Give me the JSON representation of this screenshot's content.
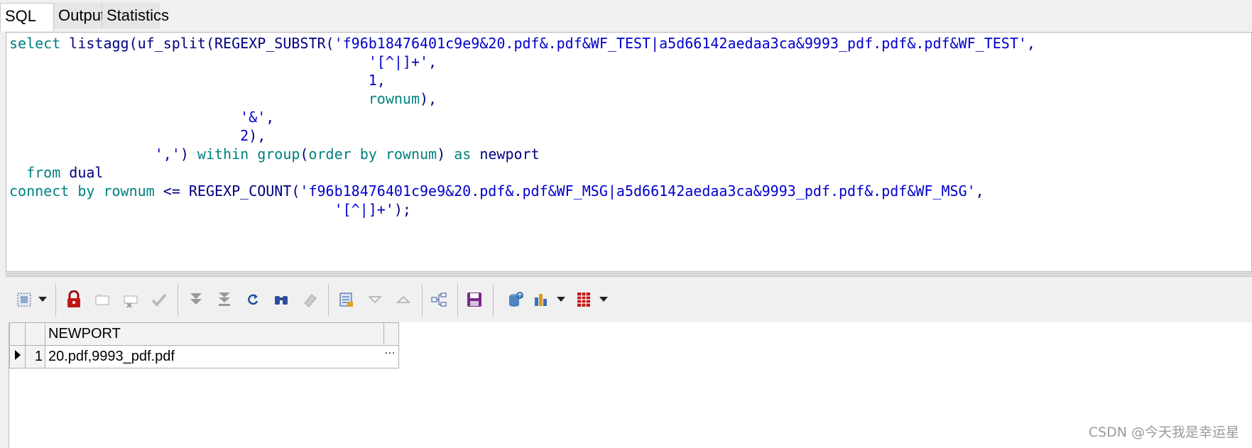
{
  "tabs": [
    {
      "label": "SQL",
      "active": true
    },
    {
      "label": "Output",
      "active": false
    },
    {
      "label": "Statistics",
      "active": false
    }
  ],
  "editor": {
    "lines": [
      [
        {
          "t": "kw",
          "v": "select"
        },
        {
          "t": "",
          "v": " "
        },
        {
          "t": "fn",
          "v": "listagg(uf_split(REGEXP_SUBSTR("
        },
        {
          "t": "str",
          "v": "'f96b18476401c9e9&20.pdf&.pdf&WF_TEST|a5d66142aedaa3ca&9993_pdf.pdf&.pdf&WF_TEST'"
        },
        {
          "t": "fn",
          "v": ","
        }
      ],
      [
        {
          "t": "",
          "v": "                                          "
        },
        {
          "t": "str",
          "v": "'[^|]+'"
        },
        {
          "t": "fn",
          "v": ","
        }
      ],
      [
        {
          "t": "",
          "v": "                                          "
        },
        {
          "t": "num",
          "v": "1"
        },
        {
          "t": "fn",
          "v": ","
        }
      ],
      [
        {
          "t": "",
          "v": "                                          "
        },
        {
          "t": "kw",
          "v": "rownum"
        },
        {
          "t": "fn",
          "v": "),"
        }
      ],
      [
        {
          "t": "",
          "v": "                           "
        },
        {
          "t": "str",
          "v": "'&'"
        },
        {
          "t": "fn",
          "v": ","
        }
      ],
      [
        {
          "t": "",
          "v": "                           "
        },
        {
          "t": "num",
          "v": "2"
        },
        {
          "t": "fn",
          "v": "),"
        }
      ],
      [
        {
          "t": "",
          "v": "                 "
        },
        {
          "t": "str",
          "v": "','"
        },
        {
          "t": "fn",
          "v": ") "
        },
        {
          "t": "kw",
          "v": "within group"
        },
        {
          "t": "fn",
          "v": "("
        },
        {
          "t": "kw",
          "v": "order by rownum"
        },
        {
          "t": "fn",
          "v": ") "
        },
        {
          "t": "kw",
          "v": "as"
        },
        {
          "t": "fn",
          "v": " newport"
        }
      ],
      [
        {
          "t": "",
          "v": "  "
        },
        {
          "t": "kw",
          "v": "from"
        },
        {
          "t": "fn",
          "v": " dual"
        }
      ],
      [
        {
          "t": "kw",
          "v": "connect by rownum"
        },
        {
          "t": "fn",
          "v": " <= REGEXP_COUNT("
        },
        {
          "t": "str",
          "v": "'f96b18476401c9e9&20.pdf&.pdf&WF_MSG|a5d66142aedaa3ca&9993_pdf.pdf&.pdf&WF_MSG'"
        },
        {
          "t": "fn",
          "v": ","
        }
      ],
      [
        {
          "t": "",
          "v": "                                      "
        },
        {
          "t": "str",
          "v": "'[^|]+'"
        },
        {
          "t": "fn",
          "v": ");"
        }
      ]
    ]
  },
  "toolbar": {
    "buttons": [
      "select-mode-icon",
      "lock-icon",
      "insert-record-icon",
      "delete-record-icon",
      "post-record-icon",
      "fetch-next-icon",
      "fetch-last-icon",
      "refresh-icon",
      "find-icon",
      "clear-icon",
      "single-record-view-icon",
      "next-record-icon",
      "previous-record-icon",
      "query-structure-icon",
      "save-icon",
      "export-icon",
      "chart-icon",
      "grid-export-icon"
    ]
  },
  "grid": {
    "columns": [
      "NEWPORT"
    ],
    "rows": [
      {
        "num": "1",
        "values": [
          "20.pdf,9993_pdf.pdf"
        ]
      }
    ],
    "ellipsis": "…"
  },
  "watermark": "CSDN @今天我是幸运星",
  "colors": {
    "keyword": "#008080",
    "string": "#0000cc",
    "identifier": "#000080"
  }
}
